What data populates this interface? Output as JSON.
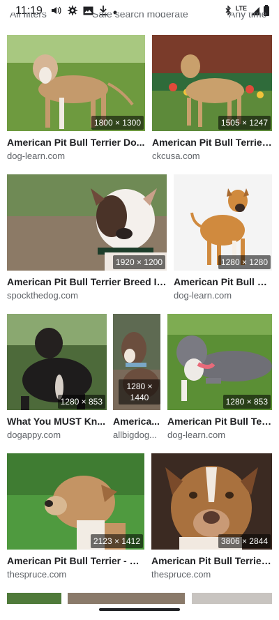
{
  "status_bar": {
    "time": "11:19",
    "network": "LTE",
    "left_icons": [
      "volume-icon",
      "settings-icon",
      "gallery-icon",
      "download-icon",
      "dot-icon"
    ],
    "right_icons": [
      "bluetooth-icon",
      "signal-icon",
      "battery-icon"
    ]
  },
  "filter_chips": [
    "All filters",
    "Safe search moderate",
    "Any time"
  ],
  "results": [
    {
      "title": "American Pit Bull Terrier Do...",
      "source": "dog-learn.com",
      "size": "1800 × 1300"
    },
    {
      "title": "American Pit Bull Terrier ...",
      "source": "ckcusa.com",
      "size": "1505 × 1247"
    },
    {
      "title": "American Pit Bull Terrier Breed In...",
      "source": "spockthedog.com",
      "size": "1920 × 1200"
    },
    {
      "title": "American Pit Bull Te...",
      "source": "dog-learn.com",
      "size": "1280 × 1280"
    },
    {
      "title": "What You MUST Kn...",
      "source": "dogappy.com",
      "size": "1280 × 853"
    },
    {
      "title": "America...",
      "source": "allbigdog...",
      "size": "1280 × 1440"
    },
    {
      "title": "American Pit Bull Ter...",
      "source": "dog-learn.com",
      "size": "1280 × 853"
    },
    {
      "title": "American Pit Bull Terrier - Fr...",
      "source": "thespruce.com",
      "size": "2123 × 1412"
    },
    {
      "title": "American Pit Bull Terrier ...",
      "source": "thespruce.com",
      "size": "3806 × 2844"
    }
  ],
  "colors": {
    "text_primary": "#202124",
    "text_secondary": "#5f6368",
    "badge_bg": "rgba(0,0,0,0.55)"
  }
}
